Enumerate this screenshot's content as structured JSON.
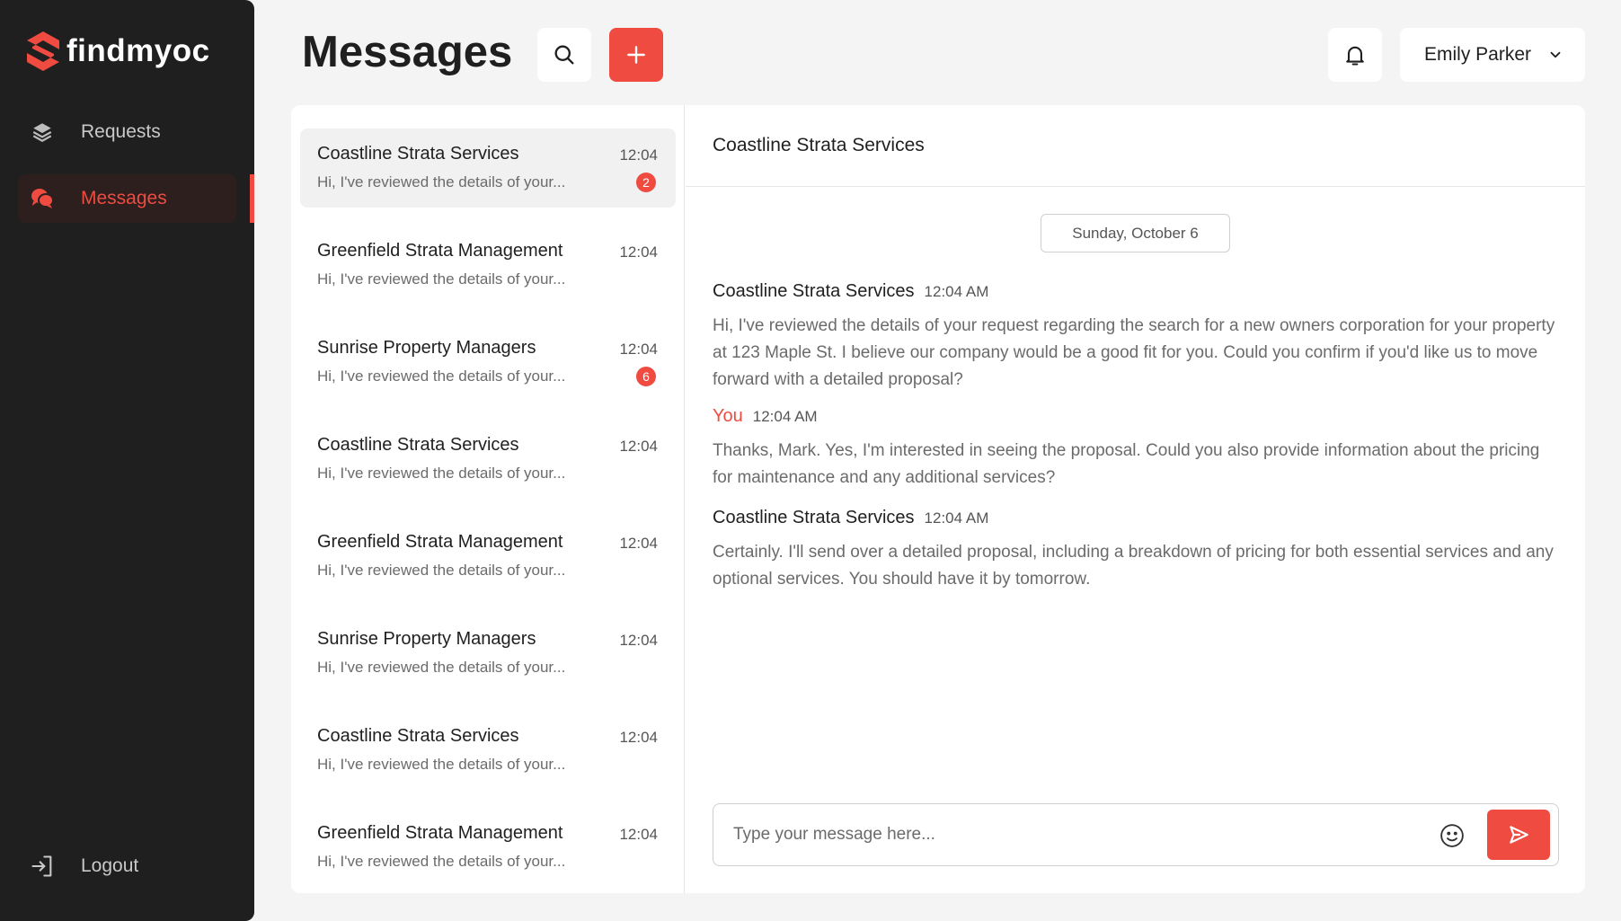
{
  "brand": {
    "name": "findmyoc",
    "accent": "#ef4b40",
    "sidebar_bg": "#1f1f1f"
  },
  "sidebar": {
    "items": [
      {
        "label": "Requests",
        "icon": "layers-icon",
        "active": false
      },
      {
        "label": "Messages",
        "icon": "chat-bubbles-icon",
        "active": true
      }
    ],
    "logout_label": "Logout"
  },
  "header": {
    "title": "Messages",
    "user_name": "Emily Parker"
  },
  "conversations": [
    {
      "name": "Coastline Strata Services",
      "time": "12:04",
      "preview": "Hi, I've reviewed the details of your...",
      "unread": "2",
      "selected": true
    },
    {
      "name": "Greenfield Strata Management",
      "time": "12:04",
      "preview": "Hi, I've reviewed the details of your...",
      "unread": null,
      "selected": false
    },
    {
      "name": "Sunrise Property Managers",
      "time": "12:04",
      "preview": "Hi, I've reviewed the details of your...",
      "unread": "6",
      "selected": false
    },
    {
      "name": "Coastline Strata Services",
      "time": "12:04",
      "preview": "Hi, I've reviewed the details of your...",
      "unread": null,
      "selected": false
    },
    {
      "name": "Greenfield Strata Management",
      "time": "12:04",
      "preview": "Hi, I've reviewed the details of your...",
      "unread": null,
      "selected": false
    },
    {
      "name": "Sunrise Property Managers",
      "time": "12:04",
      "preview": "Hi, I've reviewed the details of your...",
      "unread": null,
      "selected": false
    },
    {
      "name": "Coastline Strata Services",
      "time": "12:04",
      "preview": "Hi, I've reviewed the details of your...",
      "unread": null,
      "selected": false
    },
    {
      "name": "Greenfield Strata Management",
      "time": "12:04",
      "preview": "Hi, I've reviewed the details of your...",
      "unread": null,
      "selected": false
    }
  ],
  "chat": {
    "title": "Coastline Strata Services",
    "date_divider": "Sunday, October 6",
    "messages": [
      {
        "sender": "Coastline Strata Services",
        "time": "12:04 AM",
        "is_you": false,
        "text": "Hi, I've reviewed the details of your request regarding the search for a new owners corporation for your property at 123 Maple St. I believe our company would be a good fit for you. Could you confirm if you'd like us to move forward with a detailed proposal?"
      },
      {
        "sender": "You",
        "time": "12:04 AM",
        "is_you": true,
        "text": "Thanks, Mark. Yes, I'm interested in seeing the proposal. Could you also provide information about the pricing for maintenance and any additional services?"
      },
      {
        "sender": "Coastline Strata Services",
        "time": "12:04 AM",
        "is_you": false,
        "text": "Certainly. I'll send over a detailed proposal, including a breakdown of pricing for both essential services and any optional services. You should have it by tomorrow."
      }
    ],
    "composer": {
      "placeholder": "Type your message here...",
      "value": ""
    }
  }
}
